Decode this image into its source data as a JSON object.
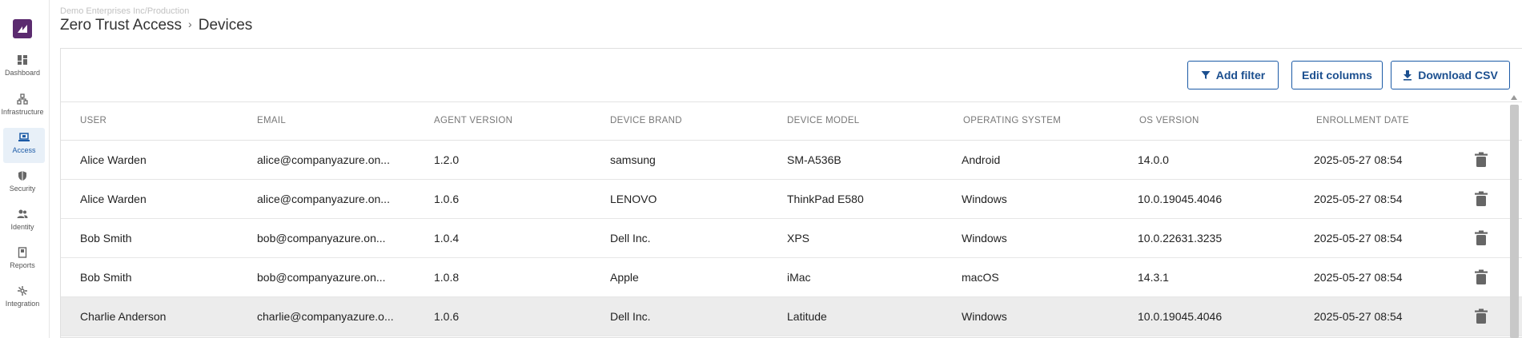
{
  "header": {
    "org_path": "Demo Enterprises Inc/Production",
    "breadcrumb": [
      "Zero Trust Access",
      "Devices"
    ],
    "separator": "›"
  },
  "sidebar": {
    "logo_icon": "brand-logo-icon",
    "items": [
      {
        "label": "Dashboard",
        "icon": "dashboard-icon",
        "active": false
      },
      {
        "label": "Infrastructure",
        "icon": "infrastructure-icon",
        "active": false
      },
      {
        "label": "Access",
        "icon": "access-icon",
        "active": true
      },
      {
        "label": "Security",
        "icon": "security-icon",
        "active": false
      },
      {
        "label": "Identity",
        "icon": "identity-icon",
        "active": false
      },
      {
        "label": "Reports",
        "icon": "reports-icon",
        "active": false
      },
      {
        "label": "Integration",
        "icon": "integration-icon",
        "active": false
      }
    ]
  },
  "toolbar": {
    "add_filter_label": "Add filter",
    "edit_columns_label": "Edit columns",
    "download_csv_label": "Download CSV"
  },
  "table": {
    "columns": [
      "USER",
      "EMAIL",
      "AGENT VERSION",
      "DEVICE BRAND",
      "DEVICE MODEL",
      "OPERATING SYSTEM",
      "OS VERSION",
      "ENROLLMENT DATE"
    ],
    "rows": [
      [
        "Alice Warden",
        "alice@companyazure.on...",
        "1.2.0",
        "samsung",
        "SM-A536B",
        "Android",
        "14.0.0",
        "2025-05-27 08:54"
      ],
      [
        "Alice Warden",
        "alice@companyazure.on...",
        "1.0.6",
        "LENOVO",
        "ThinkPad E580",
        "Windows",
        "10.0.19045.4046",
        "2025-05-27 08:54"
      ],
      [
        "Bob Smith",
        "bob@companyazure.on...",
        "1.0.4",
        "Dell Inc.",
        "XPS",
        "Windows",
        "10.0.22631.3235",
        "2025-05-27 08:54"
      ],
      [
        "Bob Smith",
        "bob@companyazure.on...",
        "1.0.8",
        "Apple",
        "iMac",
        "macOS",
        "14.3.1",
        "2025-05-27 08:54"
      ],
      [
        "Charlie Anderson",
        "charlie@companyazure.o...",
        "1.0.6",
        "Dell Inc.",
        "Latitude",
        "Windows",
        "10.0.19045.4046",
        "2025-05-27 08:54"
      ]
    ],
    "hovered_row": 4
  },
  "colors": {
    "accent": "#1b5aa6",
    "brand": "#5b2b6f",
    "active_nav_bg": "#e8f0f8",
    "hover_row_bg": "#ececec"
  }
}
